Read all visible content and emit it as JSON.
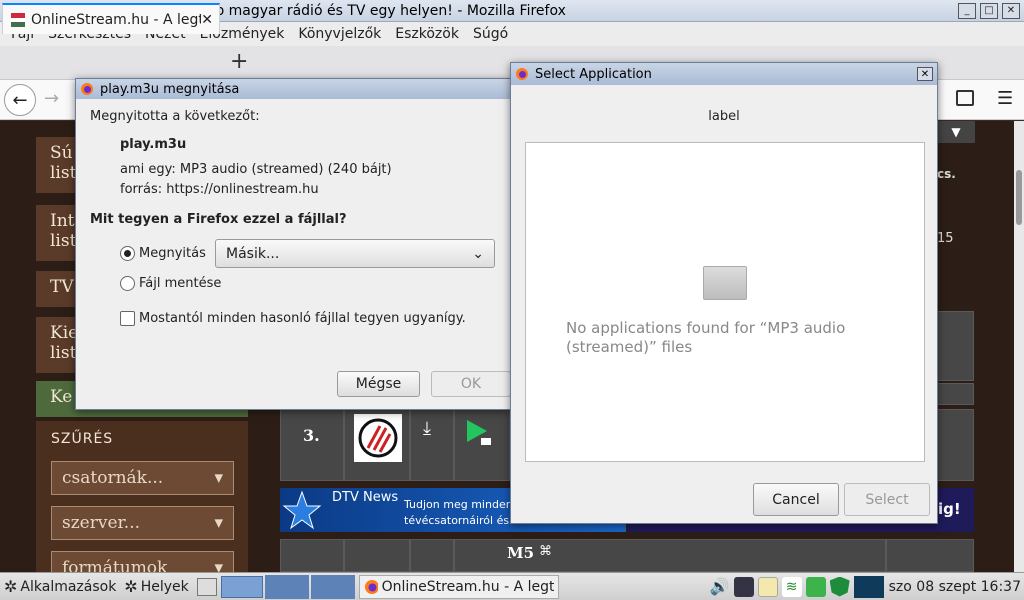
{
  "window": {
    "title": "OnlineStream.hu - A legtöbb magyar rádió és TV egy helyen! - Mozilla Firefox"
  },
  "menu": {
    "items": [
      "Fájl",
      "Szerkesztés",
      "Nézet",
      "Előzmények",
      "Könyvjelzők",
      "Eszközök",
      "Súgó"
    ]
  },
  "tab": {
    "label": "OnlineStream.hu - A legtö"
  },
  "page": {
    "sidebar": [
      "Sú\nlist",
      "Int\nlist",
      "TV",
      "Kie\nlist",
      "Ke"
    ],
    "filter_title": "SZŰRÉS",
    "filters": [
      "csatornák...",
      "szerver...",
      "formátumok"
    ],
    "rank": "3.",
    "banner_name": "DTV News",
    "banner_line": "Tudjon meg minden",
    "banner_line2": "tévécsatornáiról és",
    "channel_m5": "M5",
    "cut_text_1": "cs.",
    "cut_text_2": "15",
    "cut_text_3": "ig!"
  },
  "open_dialog": {
    "title": "play.m3u megnyitása",
    "intro": "Megnyitotta a következőt:",
    "filename": "play.m3u",
    "type_line": "ami egy: MP3 audio (streamed) (240 bájt)",
    "source_line": "forrás: https://onlinestream.hu",
    "question": "Mit tegyen a Firefox ezzel a fájllal?",
    "open_label": "Megnyitás",
    "open_select": "Másik...",
    "save_label": "Fájl mentése",
    "remember_label": "Mostantól minden hasonló fájllal tegyen ugyanígy.",
    "cancel": "Mégse",
    "ok": "OK"
  },
  "select_dialog": {
    "title": "Select Application",
    "label": "label",
    "empty_text": "No applications found for “MP3 audio (streamed)” files",
    "cancel": "Cancel",
    "select": "Select"
  },
  "taskbar": {
    "apps": "Alkalmazások",
    "places": "Helyek",
    "window_btn": "OnlineStream.hu - A legtöbb",
    "clock": "szo 08 szept 16:37"
  },
  "colors": {
    "accent": "#0a84ff",
    "page_bg": "#2c1e16",
    "sidebar": "#5a3a28"
  }
}
